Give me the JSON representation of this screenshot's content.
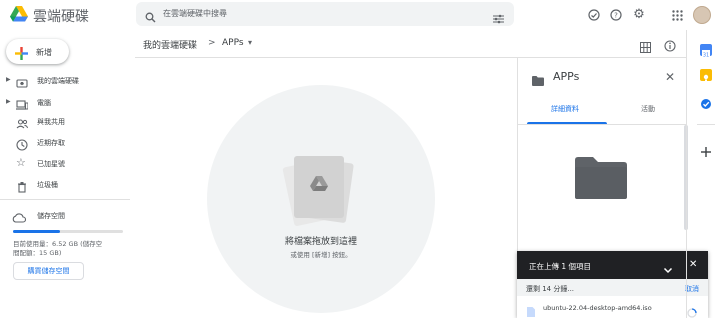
{
  "app": {
    "title": "雲端硬碟"
  },
  "search": {
    "placeholder": "在雲端硬碟中搜尋"
  },
  "sidebar": {
    "new_label": "新增",
    "items": [
      {
        "label": "我的雲端硬碟",
        "icon": "drive-folder-icon"
      },
      {
        "label": "電腦",
        "icon": "computer-icon"
      },
      {
        "label": "與我共用",
        "icon": "shared-icon"
      },
      {
        "label": "近期存取",
        "icon": "clock-icon"
      },
      {
        "label": "已加星號",
        "icon": "star-icon"
      },
      {
        "label": "垃圾桶",
        "icon": "trash-icon"
      }
    ],
    "storage": {
      "label": "儲存空間",
      "usage_line1": "目前使用量：6.52 GB (儲存空",
      "usage_line2": "間配額：15 GB)",
      "used_fraction": 0.43,
      "buy_label": "購買儲存空間"
    }
  },
  "breadcrumb": {
    "root": "我的雲端硬碟",
    "separator": ">",
    "current": "APPs",
    "dropdown": "▾"
  },
  "empty_state": {
    "title": "將檔案拖放到這裡",
    "subtitle": "或使用 [新增] 按鈕。"
  },
  "details": {
    "title": "APPs",
    "tabs": [
      {
        "label": "詳細資料",
        "active": true
      },
      {
        "label": "活動",
        "active": false
      }
    ]
  },
  "upload": {
    "title": "正在上傳 1 個項目",
    "remaining": "還剩 14 分鐘...",
    "cancel": "取消",
    "file_name": "ubuntu-22.04-desktop-amd64.iso"
  },
  "colors": {
    "accent": "#1a73e8",
    "toast_bg": "#202124",
    "annotation": "#d93025"
  }
}
